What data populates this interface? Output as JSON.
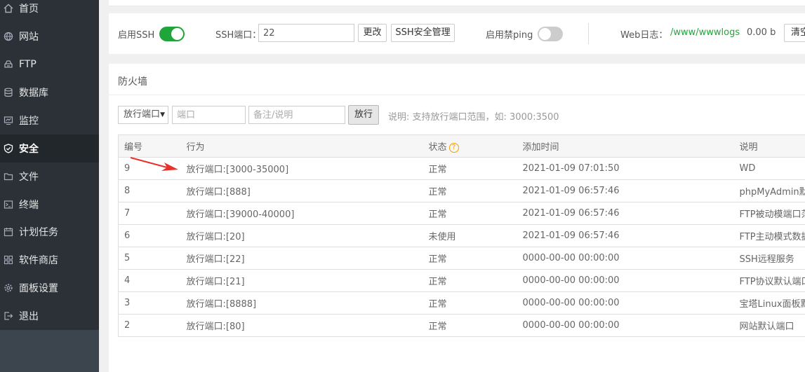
{
  "sidebar": {
    "items": [
      {
        "label": "首页",
        "icon": "home-icon",
        "active": false
      },
      {
        "label": "网站",
        "icon": "globe-icon",
        "active": false
      },
      {
        "label": "FTP",
        "icon": "ftp-icon",
        "active": false
      },
      {
        "label": "数据库",
        "icon": "database-icon",
        "active": false
      },
      {
        "label": "监控",
        "icon": "monitor-icon",
        "active": false
      },
      {
        "label": "安全",
        "icon": "shield-icon",
        "active": true
      },
      {
        "label": "文件",
        "icon": "folder-icon",
        "active": false
      },
      {
        "label": "终端",
        "icon": "terminal-icon",
        "active": false
      },
      {
        "label": "计划任务",
        "icon": "calendar-icon",
        "active": false
      },
      {
        "label": "软件商店",
        "icon": "apps-icon",
        "active": false
      },
      {
        "label": "面板设置",
        "icon": "gear-icon",
        "active": false
      },
      {
        "label": "退出",
        "icon": "logout-icon",
        "active": false
      }
    ]
  },
  "ssh_bar": {
    "enable_ssh_label": "启用SSH",
    "ssh_enabled": true,
    "port_label": "SSH端口：",
    "port_value": "22",
    "change_button": "更改",
    "ssh_manage_button": "SSH安全管理",
    "ping_label": "启用禁ping",
    "ping_enabled": false,
    "weblog_label": "Web日志：",
    "weblog_path": "/www/wwwlogs",
    "weblog_size": "0.00 b",
    "clear_button": "清空"
  },
  "firewall": {
    "title": "防火墙",
    "select_value": "放行端口",
    "port_placeholder": "端口",
    "note_placeholder": "备注/说明",
    "allow_button": "放行",
    "hint": "说明: 支持放行端口范围，如: 3000:3500",
    "columns": [
      "编号",
      "行为",
      "状态",
      "添加时间",
      "说明"
    ],
    "rows": [
      {
        "id": "9",
        "action": "放行端口:[3000-35000]",
        "status": "正常",
        "time": "2021-01-09 07:01:50",
        "desc": "WD"
      },
      {
        "id": "8",
        "action": "放行端口:[888]",
        "status": "正常",
        "time": "2021-01-09 06:57:46",
        "desc": "phpMyAdmin默认端口"
      },
      {
        "id": "7",
        "action": "放行端口:[39000-40000]",
        "status": "正常",
        "time": "2021-01-09 06:57:46",
        "desc": "FTP被动模端口范围"
      },
      {
        "id": "6",
        "action": "放行端口:[20]",
        "status": "未使用",
        "time": "2021-01-09 06:57:46",
        "desc": "FTP主动模式数据端口"
      },
      {
        "id": "5",
        "action": "放行端口:[22]",
        "status": "正常",
        "time": "0000-00-00 00:00:00",
        "desc": "SSH远程服务"
      },
      {
        "id": "4",
        "action": "放行端口:[21]",
        "status": "正常",
        "time": "0000-00-00 00:00:00",
        "desc": "FTP协议默认端口"
      },
      {
        "id": "3",
        "action": "放行端口:[8888]",
        "status": "正常",
        "time": "0000-00-00 00:00:00",
        "desc": "宝塔Linux面板默认端口"
      },
      {
        "id": "2",
        "action": "放行端口:[80]",
        "status": "正常",
        "time": "0000-00-00 00:00:00",
        "desc": "网站默认端口"
      }
    ]
  },
  "colors": {
    "sidebar_bg": "#2c3138",
    "sidebar_active": "#22272c",
    "accent_green": "#20a53a",
    "annotation_arrow": "#e8312a"
  }
}
